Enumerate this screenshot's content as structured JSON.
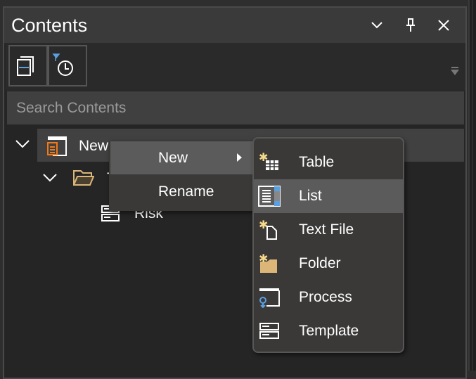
{
  "panel": {
    "title": "Contents",
    "buttons": [
      {
        "name": "dropdown",
        "icon": "chevron-down-icon"
      },
      {
        "name": "pin",
        "icon": "pin-icon"
      },
      {
        "name": "close",
        "icon": "close-icon"
      }
    ]
  },
  "toolbar": {
    "tools": [
      {
        "icon": "collapse-all-icon"
      },
      {
        "icon": "filter-recent-icon"
      }
    ],
    "overflow_icon": "overflow-arrow-icon"
  },
  "search": {
    "placeholder": "Search Contents"
  },
  "tree": [
    {
      "label": "New",
      "icon": "document-icon",
      "expanded": true,
      "selected": true
    },
    {
      "label": "T",
      "icon": "folder-open-icon",
      "expanded": true
    },
    {
      "label": "Risk",
      "icon": "template-icon"
    }
  ],
  "context_menu": {
    "items": [
      {
        "label": "New",
        "has_submenu": true,
        "highlighted": true
      },
      {
        "label": "Rename"
      }
    ]
  },
  "submenu": {
    "items": [
      {
        "label": "Table",
        "icon": "new-table-icon"
      },
      {
        "label": "List",
        "icon": "list-icon",
        "highlighted": true
      },
      {
        "label": "Text File",
        "icon": "new-text-file-icon"
      },
      {
        "label": "Folder",
        "icon": "new-folder-icon"
      },
      {
        "label": "Process",
        "icon": "process-icon"
      },
      {
        "label": "Template",
        "icon": "template-icon"
      }
    ]
  },
  "colors": {
    "accent": "#5aa0e0",
    "orange": "#f07a1a",
    "folder": "#dcb678",
    "star": "#f5d98a"
  }
}
